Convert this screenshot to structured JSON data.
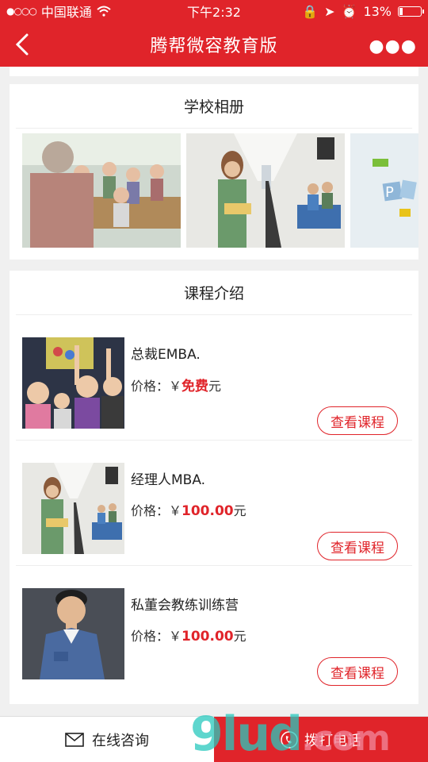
{
  "status_bar": {
    "carrier": "中国联通",
    "time": "下午2:32",
    "battery": "13%",
    "battery_level": 0.13
  },
  "header": {
    "title": "腾帮微容教育版"
  },
  "album": {
    "title": "学校相册",
    "photos": [
      "classroom-photo",
      "hallway-student-photo",
      "ppt-photo"
    ]
  },
  "courses": {
    "title": "课程介绍",
    "items": [
      {
        "name": "总裁EMBA.",
        "price_label": "价格：￥",
        "price_value": "免费",
        "unit": "元",
        "button": "查看课程"
      },
      {
        "name": "经理人MBA.",
        "price_label": "价格：￥",
        "price_value": "100.00",
        "unit": "元",
        "button": "查看课程"
      },
      {
        "name": "私董会教练训练营",
        "price_label": "价格：￥",
        "price_value": "100.00",
        "unit": "元",
        "button": "查看课程"
      }
    ]
  },
  "bottom_bar": {
    "consult_label": "在线咨询",
    "call_label": "拨打电话"
  },
  "watermark": {
    "main": "9lud",
    "suffix": ".com"
  },
  "colors": {
    "brand": "#e0242a"
  }
}
